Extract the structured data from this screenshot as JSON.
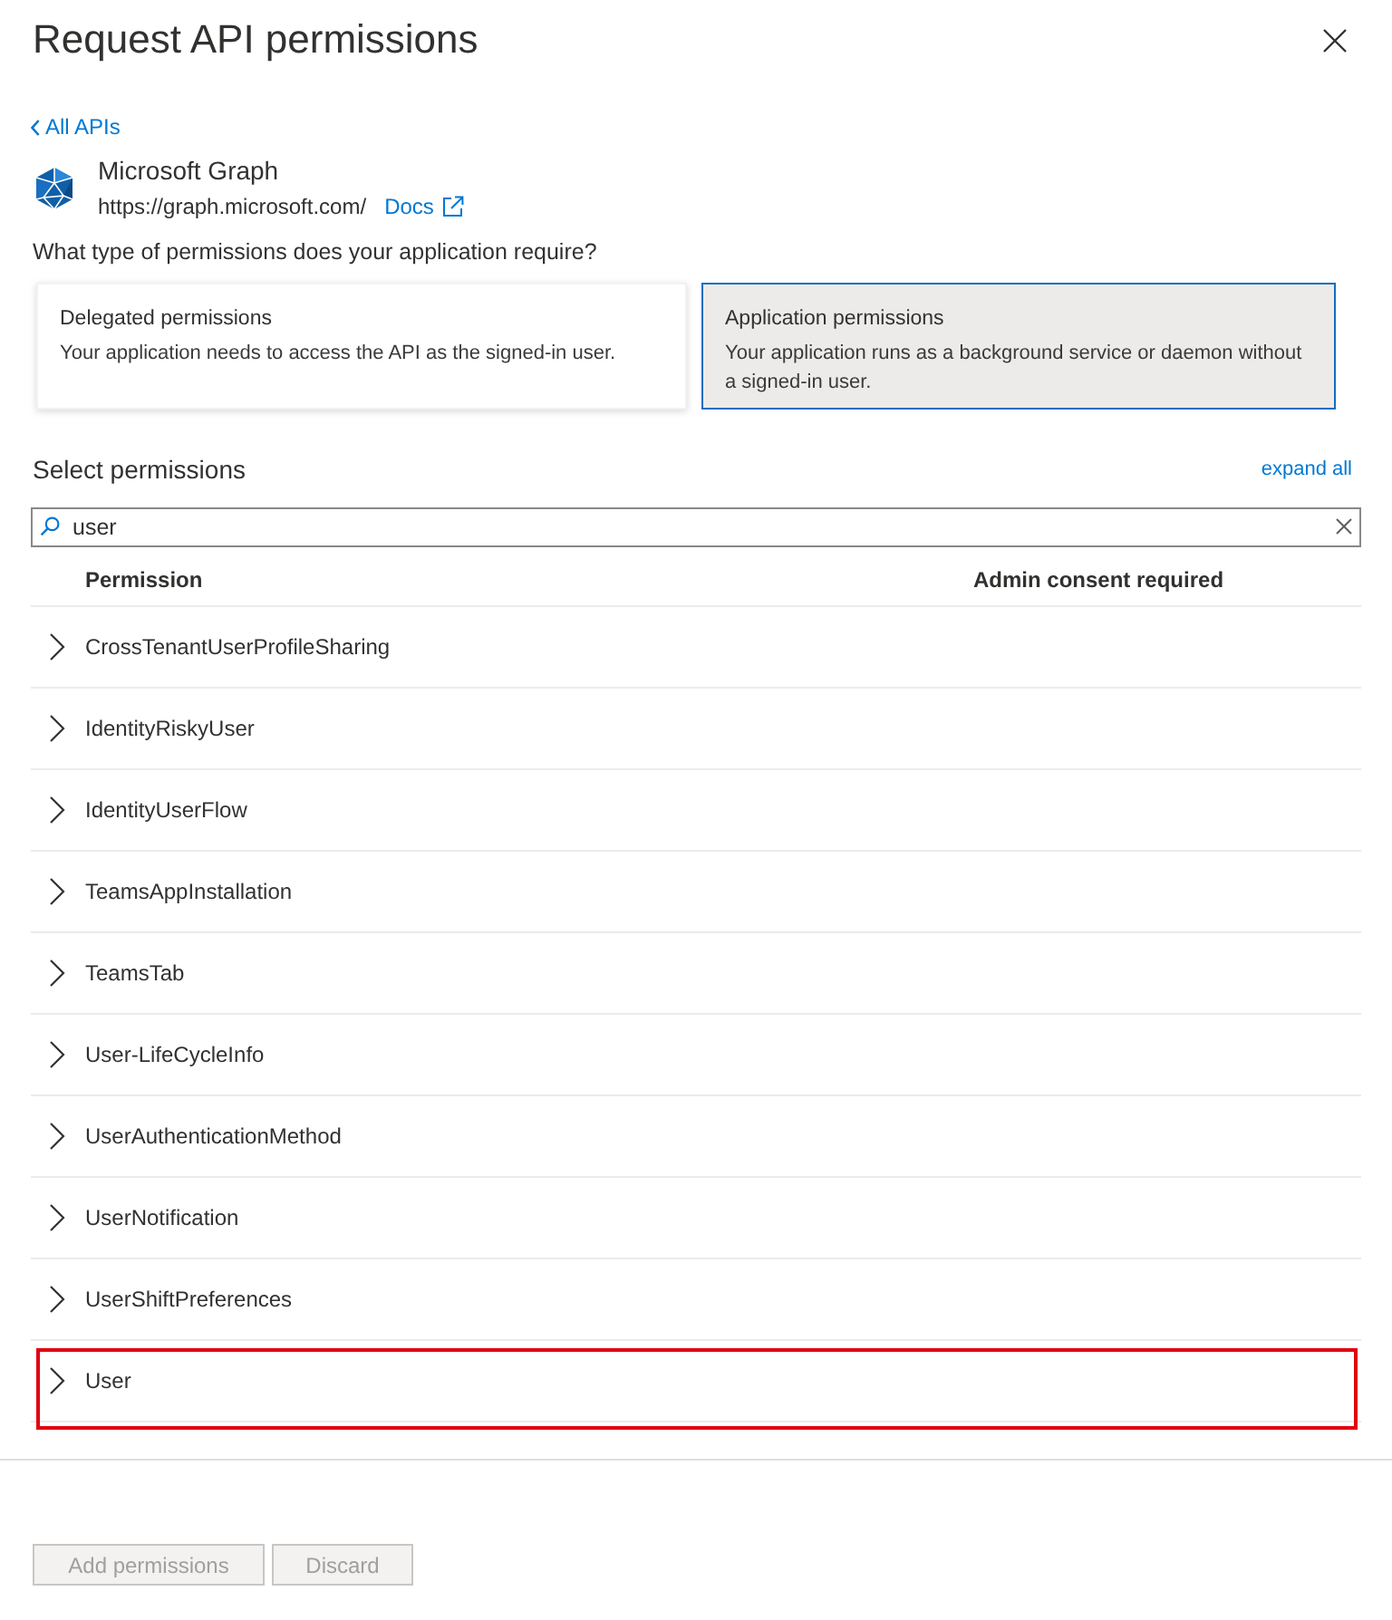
{
  "window": {
    "title": "Request API permissions"
  },
  "back_link": "All APIs",
  "api": {
    "name": "Microsoft Graph",
    "url": "https://graph.microsoft.com/",
    "docs_link": "Docs"
  },
  "question": "What type of permissions does your application require?",
  "permission_types": [
    {
      "title": "Delegated permissions",
      "description": "Your application needs to access the API as the signed-in user.",
      "selected": false
    },
    {
      "title": "Application permissions",
      "description": "Your application runs as a background service or daemon without a signed-in user.",
      "selected": true
    }
  ],
  "select_heading": "Select permissions",
  "expand_all": "expand all",
  "search": {
    "value": "user"
  },
  "table": {
    "columns": [
      "Permission",
      "Admin consent required"
    ],
    "rows": [
      {
        "name": "CrossTenantUserProfileSharing",
        "expanded": false,
        "highlighted": false
      },
      {
        "name": "IdentityRiskyUser",
        "expanded": false,
        "highlighted": false
      },
      {
        "name": "IdentityUserFlow",
        "expanded": false,
        "highlighted": false
      },
      {
        "name": "TeamsAppInstallation",
        "expanded": false,
        "highlighted": false
      },
      {
        "name": "TeamsTab",
        "expanded": false,
        "highlighted": false
      },
      {
        "name": "User-LifeCycleInfo",
        "expanded": false,
        "highlighted": false
      },
      {
        "name": "UserAuthenticationMethod",
        "expanded": false,
        "highlighted": false
      },
      {
        "name": "UserNotification",
        "expanded": false,
        "highlighted": false
      },
      {
        "name": "UserShiftPreferences",
        "expanded": false,
        "highlighted": false
      },
      {
        "name": "User",
        "expanded": false,
        "highlighted": true
      }
    ]
  },
  "buttons": [
    {
      "label": "Add permissions",
      "disabled": true
    },
    {
      "label": "Discard",
      "disabled": true
    }
  ]
}
